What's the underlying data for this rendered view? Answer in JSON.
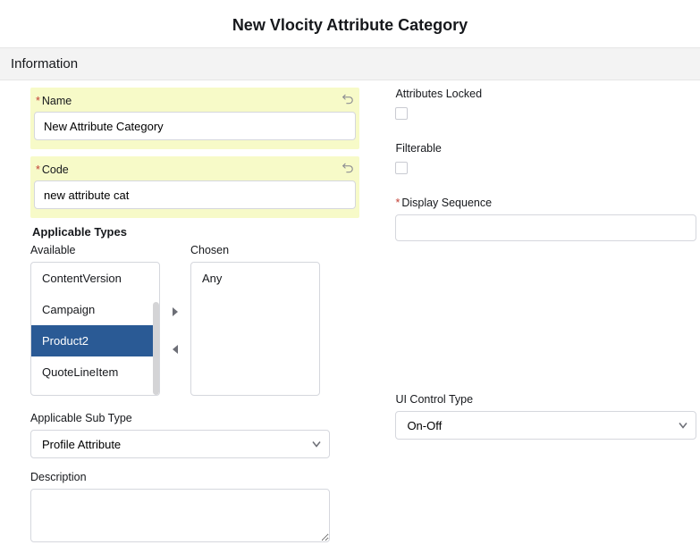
{
  "page": {
    "title": "New Vlocity Attribute Category"
  },
  "section": {
    "title": "Information"
  },
  "left": {
    "name": {
      "label": "Name",
      "value": "New Attribute Category"
    },
    "code": {
      "label": "Code",
      "value": "new attribute cat"
    },
    "applicableTypes": {
      "label": "Applicable Types",
      "availableLabel": "Available",
      "chosenLabel": "Chosen",
      "available": [
        "ContentVersion",
        "Campaign",
        "Product2",
        "QuoteLineItem"
      ],
      "selectedAvailable": "Product2",
      "chosen": [
        "Any"
      ]
    },
    "applicableSubType": {
      "label": "Applicable Sub Type",
      "value": "Profile Attribute"
    },
    "description": {
      "label": "Description",
      "value": ""
    }
  },
  "right": {
    "attributesLocked": {
      "label": "Attributes Locked",
      "checked": false
    },
    "filterable": {
      "label": "Filterable",
      "checked": false
    },
    "displaySequence": {
      "label": "Display Sequence",
      "value": ""
    },
    "uiControlType": {
      "label": "UI Control Type",
      "value": "On-Off"
    }
  }
}
